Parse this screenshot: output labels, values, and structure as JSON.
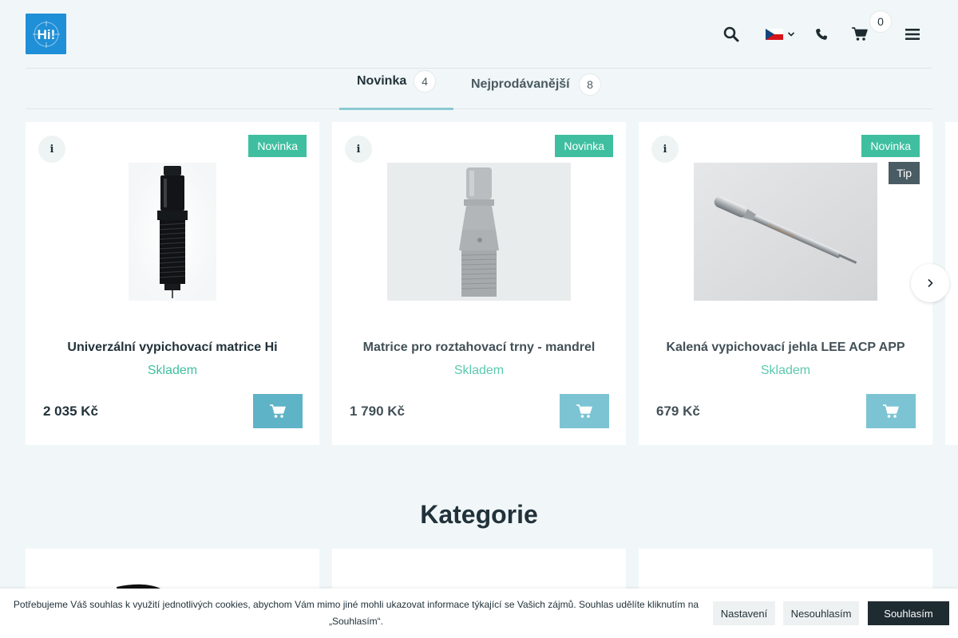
{
  "header": {
    "logo_alt": "Hi!",
    "cart_count": "0",
    "language": "CZ"
  },
  "tabs": [
    {
      "label": "Novinka",
      "count": "4",
      "active": true
    },
    {
      "label": "Nejprodávanější",
      "count": "8",
      "active": false
    }
  ],
  "products": [
    {
      "name": "Univerzální vypichovací matrice Hi",
      "stock": "Skladem",
      "price": "2 035 Kč",
      "badges": [
        "Novinka"
      ]
    },
    {
      "name": "Matrice pro roztahovací trny - mandrel",
      "stock": "Skladem",
      "price": "1 790 Kč",
      "badges": [
        "Novinka"
      ]
    },
    {
      "name": "Kalená vypichovací jehla LEE ACP APP",
      "stock": "Skladem",
      "price": "679 Kč",
      "badges": [
        "Novinka",
        "Tip"
      ]
    }
  ],
  "section": {
    "title": "Kategorie"
  },
  "cookie": {
    "text": "Potřebujeme Váš souhlas k využití jednotlivých cookies, abychom Vám mimo jiné mohli ukazovat informace týkající se Vašich zájmů. Souhlas udělíte kliknutím na „Souhlasím“.",
    "settings_label": "Nastavení",
    "decline_label": "Nesouhlasím",
    "accept_label": "Souhlasím"
  },
  "colors": {
    "accent": "#3fbfa0",
    "cart_button": "#5fb3c6",
    "logo_bg": "#1f8fd7",
    "page_bg": "#f1f7f8"
  },
  "icons": [
    "search-icon",
    "flag-cz-icon",
    "chevron-down-icon",
    "phone-icon",
    "cart-icon",
    "menu-icon",
    "info-icon",
    "add-to-cart-icon",
    "chevron-right-icon"
  ]
}
